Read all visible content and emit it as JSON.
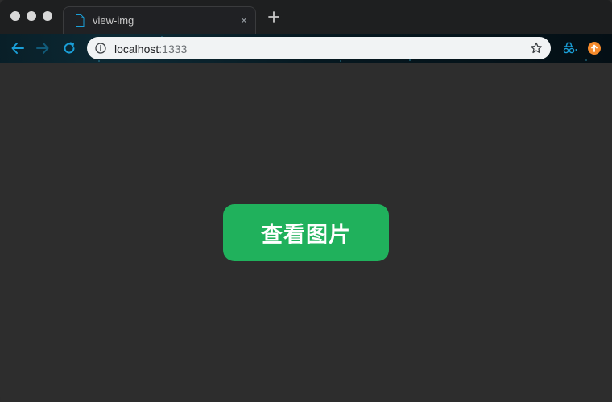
{
  "browser": {
    "tab": {
      "title": "view-img",
      "close_glyph": "×"
    },
    "address_bar": {
      "host": "localhost",
      "port": ":1333"
    },
    "colors": {
      "accent": "#1a9fd8",
      "update_badge": "#f58a2b"
    }
  },
  "page": {
    "button_label": "查看图片",
    "button_color": "#20b15c",
    "background": "#2d2d2d"
  },
  "icons": {
    "tab": "file-icon",
    "new_tab": "plus-icon",
    "back": "arrow-left-icon",
    "forward": "arrow-right-icon",
    "reload": "reload-icon",
    "info": "info-icon",
    "bookmark": "star-icon",
    "extension": "incognito-icon",
    "update": "update-icon"
  }
}
